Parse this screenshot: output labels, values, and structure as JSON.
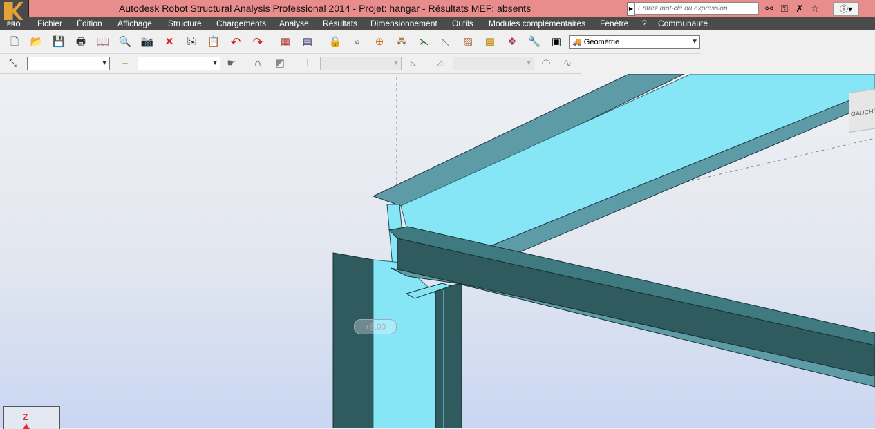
{
  "app": {
    "title": "Autodesk Robot Structural Analysis Professional 2014 - Projet: hangar - Résultats MEF: absents",
    "logo_label": "PRO"
  },
  "search": {
    "placeholder": "Entrez mot-clé ou expression"
  },
  "title_icons": [
    "binoculars-icon",
    "key-icon",
    "x-cross-icon",
    "star-icon",
    "help-icon"
  ],
  "menu": {
    "items": [
      "Fichier",
      "Édition",
      "Affichage",
      "Structure",
      "Chargements",
      "Analyse",
      "Résultats",
      "Dimensionnement",
      "Outils",
      "Modules complémentaires",
      "Fenêtre",
      "?",
      "Communauté"
    ]
  },
  "toolbar": {
    "layout_combo": "Géométrie",
    "icons": [
      "new-icon",
      "open-icon",
      "save-icon",
      "print-icon",
      "book-icon",
      "preview-icon",
      "camera-icon",
      "delete-icon",
      "copy-icon",
      "paste-icon",
      "undo-icon",
      "redo-icon",
      "calculator-icon",
      "table-icon",
      "lock-icon",
      "zoom-icon",
      "target-icon",
      "nodes-icon",
      "bars-icon",
      "section-icon",
      "hatch-icon",
      "materials-icon",
      "cube-icon",
      "wrench-icon",
      "window-icon"
    ]
  },
  "toolbar2": {
    "combo1": "",
    "combo2": "",
    "combo3": "",
    "combo4": ""
  },
  "viewport": {
    "level_label": "+8.00",
    "viewcube_label": "GAUCHE",
    "axis_label": "Z"
  },
  "colors": {
    "titlebar": "#e88c8c",
    "menubar": "#4b4b4b",
    "beam_light": "#86e6f6",
    "beam_dark": "#2f5a5e"
  }
}
